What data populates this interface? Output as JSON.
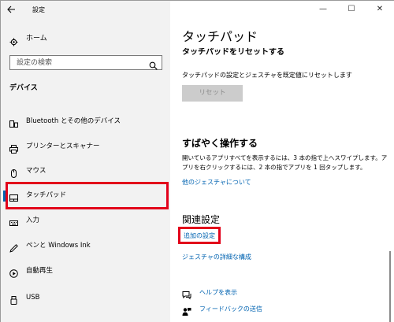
{
  "window": {
    "title": "設定",
    "back_icon": "back-arrow-icon",
    "controls": {
      "minimize": "—",
      "maximize": "☐",
      "close": "✕"
    }
  },
  "sidebar": {
    "home_label": "ホーム",
    "search_placeholder": "設定の検索",
    "section_heading": "デバイス",
    "items": [
      {
        "label": "Bluetooth とその他のデバイス",
        "icon": "bluetooth-devices-icon"
      },
      {
        "label": "プリンターとスキャナー",
        "icon": "printer-icon"
      },
      {
        "label": "マウス",
        "icon": "mouse-icon"
      },
      {
        "label": "タッチパッド",
        "icon": "touchpad-icon",
        "selected": true
      },
      {
        "label": "入力",
        "icon": "keyboard-icon"
      },
      {
        "label": "ペンと Windows Ink",
        "icon": "pen-icon"
      },
      {
        "label": "自動再生",
        "icon": "autoplay-icon"
      },
      {
        "label": "USB",
        "icon": "usb-icon"
      }
    ]
  },
  "main": {
    "page_title": "タッチパッド",
    "reset": {
      "heading": "タッチパッドをリセットする",
      "description": "タッチパッドの設定とジェスチャを既定値にリセットします",
      "button_label": "リセット"
    },
    "quick": {
      "heading": "すばやく操作する",
      "description": "開いているアプリすべてを表示するには、3 本の指で上へスワイプします。アプリを右クリックするには、2 本の指でアプリを 1 回タップします。",
      "link": "他のジェスチャについて"
    },
    "related": {
      "heading": "関連設定",
      "additional_link": "追加の設定",
      "detail_link": "ジェスチャの詳細な構成"
    },
    "help": [
      {
        "label": "ヘルプを表示",
        "icon": "help-chat-icon"
      },
      {
        "label": "フィードバックの送信",
        "icon": "feedback-icon"
      }
    ]
  },
  "colors": {
    "accent": "#0063b1",
    "highlight_frame": "#e2001a",
    "sidebar_bg": "#f2f2f2"
  }
}
